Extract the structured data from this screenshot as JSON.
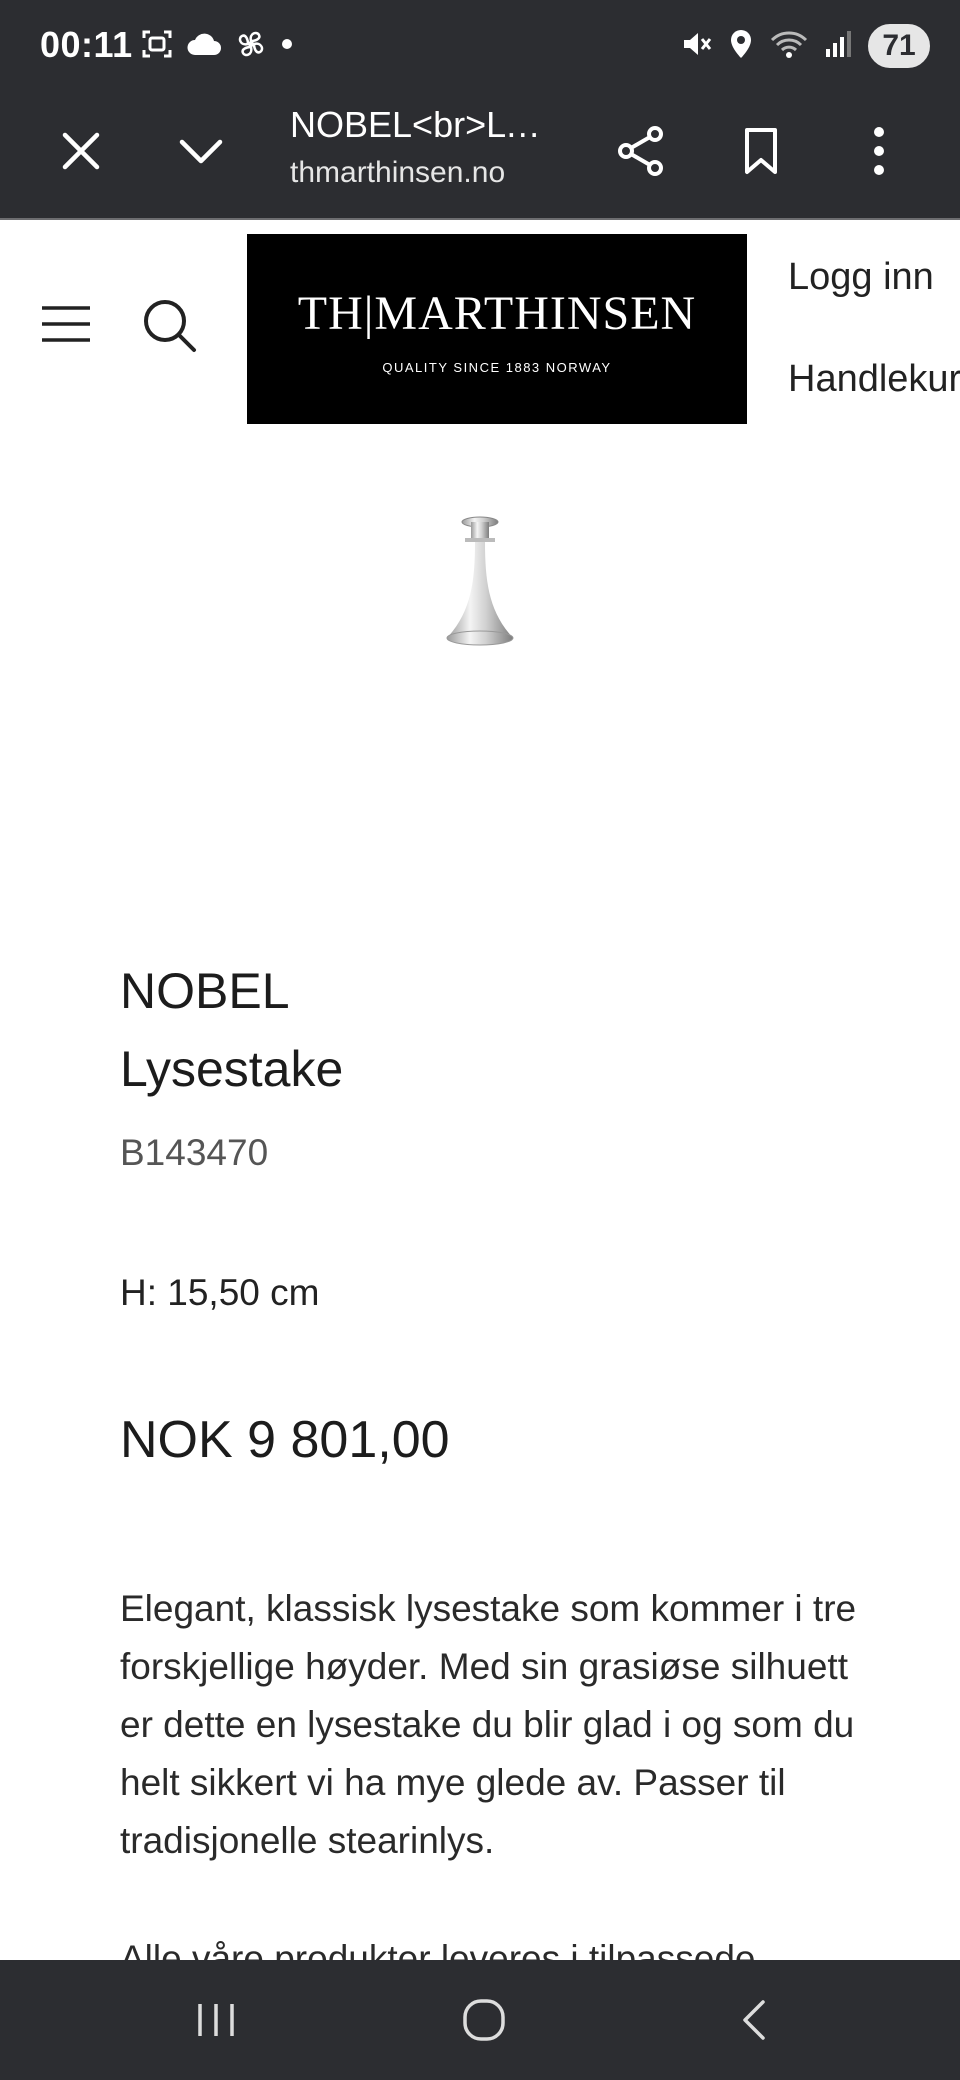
{
  "status_bar": {
    "time": "00:11",
    "battery_level": "71",
    "left_icons": [
      "screenshot-icon",
      "cloud-icon",
      "fan-icon",
      "dot-icon"
    ],
    "right_icons": [
      "mute-icon",
      "location-icon",
      "wifi-icon",
      "signal-icon"
    ]
  },
  "browser": {
    "page_title": "NOBEL<br>Lysestake",
    "url": "thmarthinsen.no",
    "buttons": [
      "close-icon",
      "chevron-down-icon",
      "share-icon",
      "bookmark-icon",
      "more-icon"
    ]
  },
  "header": {
    "logo_main": "TH|MARTHINSEN",
    "logo_sub": "QUALITY SINCE 1883   NORWAY",
    "login_label": "Logg inn",
    "cart_label": "Handlekurv"
  },
  "product": {
    "name_line1": "NOBEL",
    "name_line2": "Lysestake",
    "sku": "B143470",
    "dimension": "H: 15,50 cm",
    "price": "NOK 9 801,00",
    "description": "Elegant, klassisk lysestake som kommer i tre forskjellige høyder. Med sin grasiøse silhuett er dette en lysestake du blir glad i og som du helt sikkert vi ha mye glede av. Passer til tradisjonelle stearinlys.",
    "description_2": "Alle våre produkter leveres i tilpassede"
  },
  "colors": {
    "system_bar": "#2c2d31",
    "logo_background": "#000000",
    "text": "#222222"
  }
}
